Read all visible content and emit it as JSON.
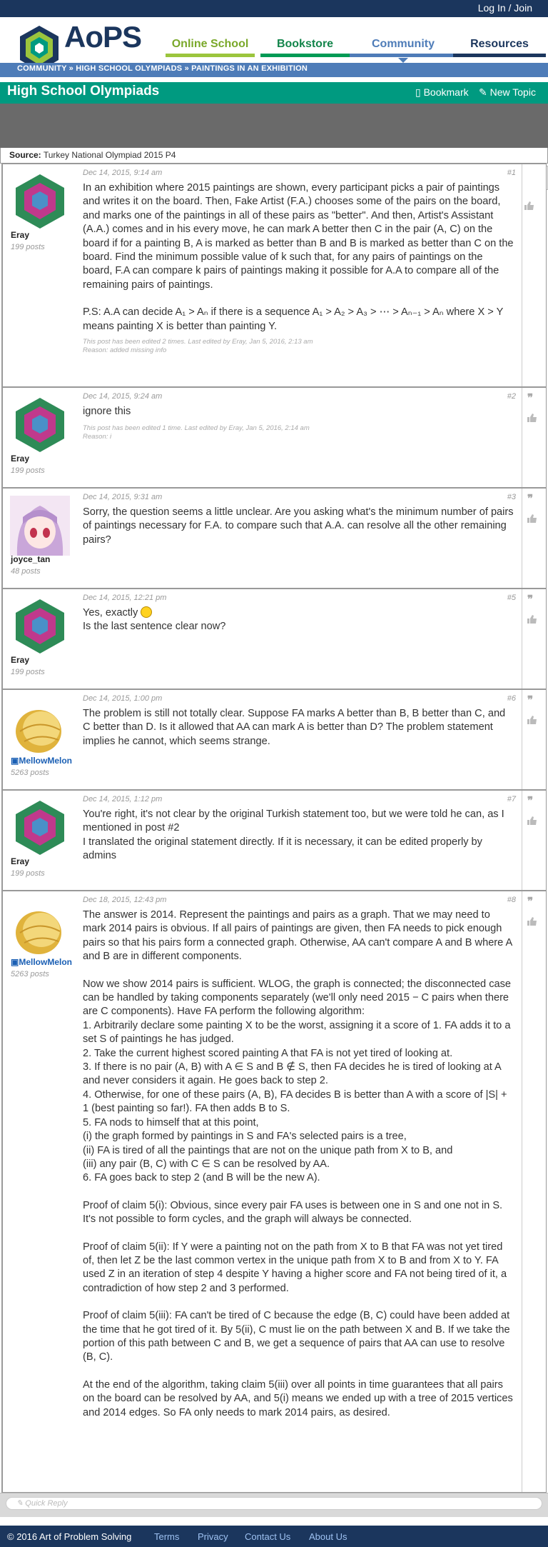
{
  "header": {
    "login_label": "Log In / Join",
    "logo_text": "AoPS",
    "nav": [
      "Online School",
      "Bookstore",
      "Community",
      "Resources"
    ]
  },
  "breadcrumb": {
    "text": "COMMUNITY » HIGH SCHOOL OLYMPIADS » PAINTINGS IN AN EXHIBITION"
  },
  "forum": {
    "title": "High School Olympiads",
    "bookmark_label": "Bookmark",
    "newtopic_label": "New Topic"
  },
  "source": {
    "label": "Source:",
    "value": "Turkey National Olympiad 2015 P4"
  },
  "posts": [
    {
      "user": "Eray",
      "posts": "199 posts",
      "date": "Dec 14, 2015, 9:14 am",
      "num": "#1",
      "text": [
        "In an exhibition where 2015 paintings are shown, every participant picks a pair of paintings and writes it on the board. Then, Fake Artist (F.A.) chooses some of the pairs on the board, and marks one of the paintings in all of these pairs as \"better\". And then, Artist's Assistant (A.A.) comes and in his every move, he can mark A better then C in the pair (A, C) on the board if for a painting B, A is marked as better than B and B is marked as better than C on the board. Find the minimum possible value of k such that, for any pairs of paintings on the board, F.A can compare k pairs of paintings making it possible for A.A to compare all of the remaining pairs of paintings.",
        "P.S: A.A can decide A₁ > Aₙ if there is a sequence A₁ > A₂ > A₃ > ⋯ > Aₙ₋₁ > Aₙ where X > Y means painting X is better than painting Y."
      ],
      "edit": "This post has been edited 2 times. Last edited by Eray, Jan 5, 2016, 2:13 am",
      "reason": "Reason: added missing info"
    },
    {
      "user": "Eray",
      "posts": "199 posts",
      "date": "Dec 14, 2015, 9:24 am",
      "num": "#2",
      "text": [
        "ignore this"
      ],
      "edit": "This post has been edited 1 time. Last edited by Eray, Jan 5, 2016, 2:14 am",
      "reason": "Reason: i"
    },
    {
      "user": "joyce_tan",
      "posts": "48 posts",
      "date": "Dec 14, 2015, 9:31 am",
      "num": "#3",
      "text": [
        "Sorry, the question seems a little unclear. Are you asking what's the minimum number of pairs of paintings necessary for F.A. to compare such that A.A. can resolve all the other remaining pairs?"
      ]
    },
    {
      "user": "Eray",
      "posts": "199 posts",
      "date": "Dec 14, 2015, 12:21 pm",
      "num": "#5",
      "text": [
        "Yes, exactly",
        "Is the last sentence clear now?"
      ]
    },
    {
      "user": "MellowMelon",
      "posts": "5263 posts",
      "date": "Dec 14, 2015, 1:00 pm",
      "num": "#6",
      "text": [
        "The problem is still not totally clear. Suppose FA marks A better than B, B better than C, and C better than D. Is it allowed that AA can mark A is better than D? The problem statement implies he cannot, which seems strange."
      ]
    },
    {
      "user": "Eray",
      "posts": "199 posts",
      "date": "Dec 14, 2015, 1:12 pm",
      "num": "#7",
      "text": [
        "You're right, it's not clear by the original Turkish statement too, but we were told he can, as I mentioned in post #2",
        "I translated the original statement directly. If it is necessary, it can be edited properly by admins"
      ]
    },
    {
      "user": "MellowMelon",
      "posts": "5263 posts",
      "date": "Dec 18, 2015, 12:43 pm",
      "num": "#8",
      "text": [
        "The answer is 2014. Represent the paintings and pairs as a graph. That we may need to mark 2014 pairs is obvious. If all pairs of paintings are given, then FA needs to pick enough pairs so that his pairs form a connected graph. Otherwise, AA can't compare A and B where A and B are in different components.",
        "Now we show 2014 pairs is sufficient. WLOG, the graph is connected; the disconnected case can be handled by taking components separately (we'll only need 2015 − C pairs when there are C components). Have FA perform the following algorithm:",
        "1. Arbitrarily declare some painting X to be the worst, assigning it a score of 1. FA adds it to a set S of paintings he has judged.",
        "2. Take the current highest scored painting A that FA is not yet tired of looking at.",
        "3. If there is no pair (A, B) with A ∈ S and B ∉ S, then FA decides he is tired of looking at A and never considers it again. He goes back to step 2.",
        "4. Otherwise, for one of these pairs (A, B), FA decides B is better than A with a score of |S| + 1 (best painting so far!). FA then adds B to S.",
        "5. FA nods to himself that at this point,",
        "(i) the graph formed by paintings in S and FA's selected pairs is a tree,",
        "(ii) FA is tired of all the paintings that are not on the unique path from X to B, and",
        "(iii) any pair (B, C) with C ∈ S can be resolved by AA.",
        "6. FA goes back to step 2 (and B will be the new A).",
        "Proof of claim 5(i): Obvious, since every pair FA uses is between one in S and one not in S. It's not possible to form cycles, and the graph will always be connected.",
        "Proof of claim 5(ii): If Y were a painting not on the path from X to B that FA was not yet tired of, then let Z be the last common vertex in the unique path from X to B and from X to Y. FA used Z in an iteration of step 4 despite Y having a higher score and FA not being tired of it, a contradiction of how step 2 and 3 performed.",
        "Proof of claim 5(iii): FA can't be tired of C because the edge (B, C) could have been added at the time that he got tired of it. By 5(ii), C must lie on the path between X and B. If we take the portion of this path between C and B, we get a sequence of pairs that AA can use to resolve (B, C).",
        "At the end of the algorithm, taking claim 5(iii) over all points in time guarantees that all pairs on the board can be resolved by AA, and 5(i) means we ended up with a tree of 2015 vertices and 2014 edges. So FA only needs to mark 2014 pairs, as desired."
      ]
    }
  ],
  "quick_reply": {
    "placeholder": "Quick Reply"
  },
  "footer": {
    "copyright": "© 2016 Art of Problem Solving",
    "links": [
      "Terms",
      "Privacy",
      "Contact Us",
      "About Us"
    ]
  }
}
